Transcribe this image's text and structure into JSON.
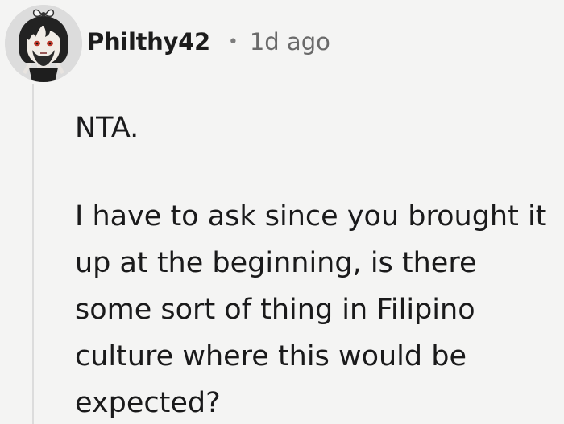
{
  "comment": {
    "author": "Philthy42",
    "separator": "•",
    "timestamp": "1d ago",
    "avatar_icon": "cartoon-avatar-icon",
    "paragraphs": [
      "NTA.",
      "I have to ask since you brought it up at the beginning, is there some sort of thing in Filipino culture where this would be expected?"
    ]
  },
  "colors": {
    "background": "#f4f4f3",
    "text": "#1a1a1b",
    "meta_text": "#6a6a6a",
    "thread_line": "#dcdcdc"
  }
}
